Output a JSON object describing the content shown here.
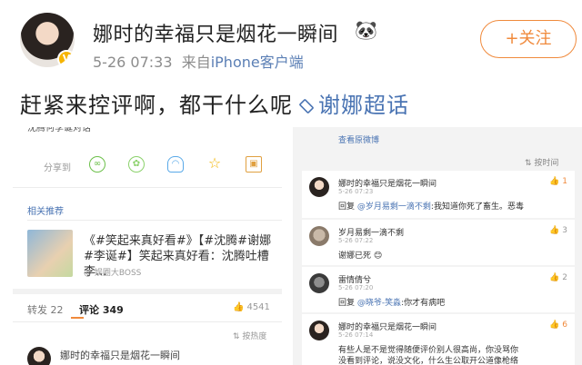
{
  "post": {
    "author": "娜时的幸福只是烟花一瞬间",
    "emoji": "🐼",
    "verified_badge": "V",
    "time": "5-26 07:33",
    "source_prefix": "来自",
    "source": "iPhone客户端",
    "follow_label": "+关注",
    "text": "赶紧来控评啊，都干什么呢",
    "topic": "谢娜超话"
  },
  "left_screenshot": {
    "share_label": "分享到",
    "share_icons": [
      "wechat-icon",
      "moments-icon",
      "qq-icon",
      "favorite-icon",
      "image-icon"
    ],
    "recommend_label": "相关推荐",
    "recommend_title": "《#笑起来真好看#》【#沈腾#谢娜#李诞#】笑起来真好看：沈腾吐槽李...",
    "recommend_source": "@ 娱圈大BOSS",
    "tab_repost": "转发 22",
    "tab_comment": "评论 349",
    "likes": "4541",
    "sort_label": "按热度",
    "comment_author": "娜时的幸福只是烟花一瞬间"
  },
  "right_screenshot": {
    "view_original": "查看原微博",
    "sort_label": "按时间",
    "comments": [
      {
        "name": "娜时的幸福只是烟花一瞬间",
        "time": "5-26 07:23",
        "likes": "1",
        "hot": true,
        "reply_prefix": "回复",
        "at": "@岁月易剩一滴不剩",
        "text": ":我知道你死了畜生。恶毒"
      },
      {
        "name": "岁月易剩一滴不剩",
        "time": "5-26 07:22",
        "likes": "3",
        "hot": false,
        "reply_prefix": "",
        "at": "",
        "text": "谢娜已死 😊"
      },
      {
        "name": "雷情倩兮",
        "time": "5-26 07:20",
        "likes": "2",
        "hot": false,
        "reply_prefix": "回复",
        "at": "@晓爷-笑淼",
        "text": ":你才有病吧"
      },
      {
        "name": "娜时的幸福只是烟花一瞬间",
        "time": "5-26 07:14",
        "likes": "6",
        "hot": true,
        "reply_prefix": "",
        "at": "",
        "text": "有些人是不是觉得随便评价别人很高尚，你没骂你"
      }
    ],
    "overflow_text": "没看到评论，说没文化，什么生公取开公道像枪络"
  },
  "colors": {
    "accent": "#f08a3c",
    "link": "#4a74b3",
    "meta": "#8c8c8c"
  }
}
